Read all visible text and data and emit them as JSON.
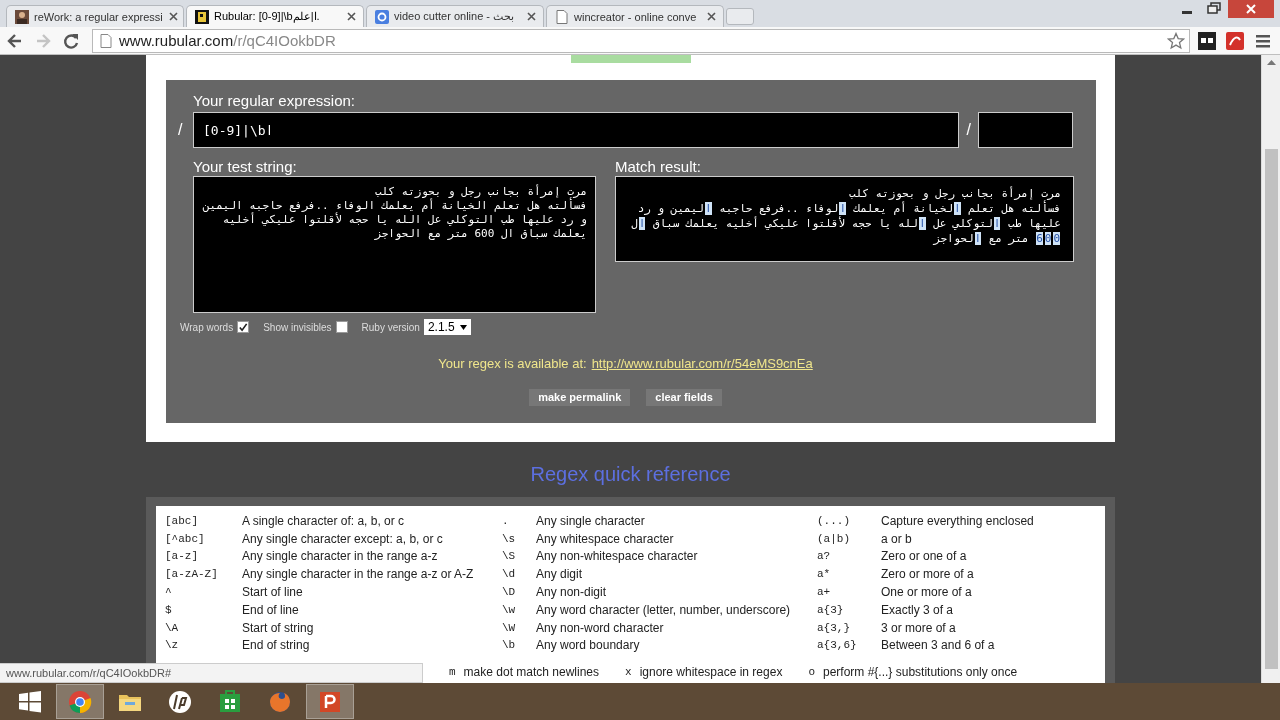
{
  "browser": {
    "tabs": [
      {
        "title": "reWork: a regular expressi",
        "selected": false
      },
      {
        "title": "Rubular: [0-9]|\\bا|علم.",
        "selected": true
      },
      {
        "title": "video cutter online - بحث",
        "selected": false
      },
      {
        "title": "wincreator - online conve",
        "selected": false
      }
    ],
    "address": {
      "host": "www.rubular.com",
      "path": "/r/qC4IOokbDR"
    }
  },
  "page": {
    "regex": {
      "label": "Your regular expression:",
      "open_slash": "/",
      "value": "[0-9]|\\bا",
      "close_slash": "/"
    },
    "test_string": {
      "label": "Your test string:",
      "value": "مرت إمرأة بجانب رجل و بحوزته كلب\nفسألته هل تعلم الخيانة أم يعلمك الوفاء ..فرفع حاجبه اليمين و رد عليها طب التوكلي عل الله يا حجه لأقلتوا عليكي أخليه يعلمك سباق ال 600 متر مع الحواجز"
    },
    "match_result": {
      "label": "Match result:",
      "segments": [
        {
          "text": "مرت إمرأة بجانب رجل و بحوزته كلب\nفسألته هل تعلم ",
          "match": false
        },
        {
          "text": "ا",
          "match": true
        },
        {
          "text": "لخيانة أم يعلمك ",
          "match": false
        },
        {
          "text": "ا",
          "match": true
        },
        {
          "text": "لوفاء ..فرفع حاجبه ",
          "match": false
        },
        {
          "text": "ا",
          "match": true
        },
        {
          "text": "ليمين و رد عليها طب ",
          "match": false
        },
        {
          "text": "ا",
          "match": true
        },
        {
          "text": "لتوكلي عل ",
          "match": false
        },
        {
          "text": "ا",
          "match": true
        },
        {
          "text": "لله يا حجه لأقلتوا عليكي أخليه يعلمك سباق ",
          "match": false
        },
        {
          "text": "ا",
          "match": true
        },
        {
          "text": "ل ",
          "match": false
        },
        {
          "text": "600",
          "match": true
        },
        {
          "text": " متر مع ",
          "match": false
        },
        {
          "text": "ا",
          "match": true
        },
        {
          "text": "لحواجز",
          "match": false
        }
      ]
    },
    "options": [
      {
        "kind": "checkbox",
        "label": "Wrap words",
        "checked": true
      },
      {
        "kind": "checkbox",
        "label": "Show invisibles",
        "checked": false
      },
      {
        "kind": "select",
        "label": "Ruby version",
        "value": "2.1.5"
      }
    ],
    "permalink": {
      "prefix": "Your regex is available at:",
      "url": "http://www.rubular.com/r/54eMS9cnEa"
    },
    "buttons": [
      "make permalink",
      "clear fields"
    ],
    "quick_reference": {
      "title": "Regex quick reference",
      "rows": [
        [
          {
            "token": "[abc]",
            "description": "A single character of: a, b, or c"
          },
          {
            "token": ".",
            "description": "Any single character"
          },
          {
            "token": "(...)",
            "description": "Capture everything enclosed"
          }
        ],
        [
          {
            "token": "[^abc]",
            "description": "Any single character except: a, b, or c"
          },
          {
            "token": "\\s",
            "description": "Any whitespace character"
          },
          {
            "token": "(a|b)",
            "description": "a or b"
          }
        ],
        [
          {
            "token": "[a-z]",
            "description": "Any single character in the range a-z"
          },
          {
            "token": "\\S",
            "description": "Any non-whitespace character"
          },
          {
            "token": "a?",
            "description": "Zero or one of a"
          }
        ],
        [
          {
            "token": "[a-zA-Z]",
            "description": "Any single character in the range a-z or A-Z"
          },
          {
            "token": "\\d",
            "description": "Any digit"
          },
          {
            "token": "a*",
            "description": "Zero or more of a"
          }
        ],
        [
          {
            "token": "^",
            "description": "Start of line"
          },
          {
            "token": "\\D",
            "description": "Any non-digit"
          },
          {
            "token": "a+",
            "description": "One or more of a"
          }
        ],
        [
          {
            "token": "$",
            "description": "End of line"
          },
          {
            "token": "\\w",
            "description": "Any word character (letter, number, underscore)"
          },
          {
            "token": "a{3}",
            "description": "Exactly 3 of a"
          }
        ],
        [
          {
            "token": "\\A",
            "description": "Start of string"
          },
          {
            "token": "\\W",
            "description": "Any non-word character"
          },
          {
            "token": "a{3,}",
            "description": "3 or more of a"
          }
        ],
        [
          {
            "token": "\\z",
            "description": "End of string"
          },
          {
            "token": "\\b",
            "description": "Any word boundary"
          },
          {
            "token": "a{3,6}",
            "description": "Between 3 and 6 of a"
          }
        ]
      ],
      "flags": [
        {
          "flag": "m",
          "description": "make dot match newlines"
        },
        {
          "flag": "x",
          "description": "ignore whitespace in regex"
        },
        {
          "flag": "o",
          "description": "perform #{...} substitutions only once"
        }
      ]
    }
  },
  "status_bubble": "www.rubular.com/r/qC4IOokbDR#",
  "taskbar": [
    {
      "kind": "windows",
      "running": false
    },
    {
      "kind": "chrome",
      "running": true
    },
    {
      "kind": "folder",
      "running": false
    },
    {
      "kind": "hp",
      "running": false
    },
    {
      "kind": "store",
      "running": false
    },
    {
      "kind": "firefox",
      "running": false
    },
    {
      "kind": "powerpoint",
      "running": true
    }
  ]
}
